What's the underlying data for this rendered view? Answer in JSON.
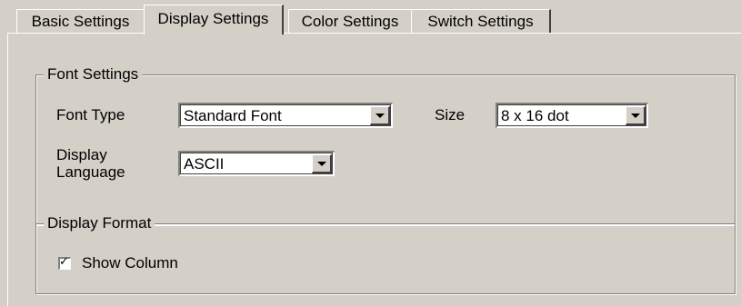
{
  "tabs": [
    {
      "label": "Basic Settings",
      "active": false
    },
    {
      "label": "Display Settings",
      "active": true
    },
    {
      "label": "Color Settings",
      "active": false
    },
    {
      "label": "Switch Settings",
      "active": false
    }
  ],
  "font_settings": {
    "legend": "Font Settings",
    "font_type_label": "Font Type",
    "font_type_value": "Standard Font",
    "size_label": "Size",
    "size_value": "8 x 16 dot",
    "display_language_label_line1": "Display",
    "display_language_label_line2": "Language",
    "display_language_value": "ASCII",
    "dropdown_icon": "chevron-down-icon"
  },
  "display_format": {
    "legend": "Display Format",
    "show_column_label": "Show Column",
    "show_column_checked": true,
    "check_glyph": "✓"
  },
  "colors": {
    "face": "#d4d0c8",
    "highlight": "#ffffff",
    "shadow": "#808080",
    "dark_shadow": "#404040"
  }
}
